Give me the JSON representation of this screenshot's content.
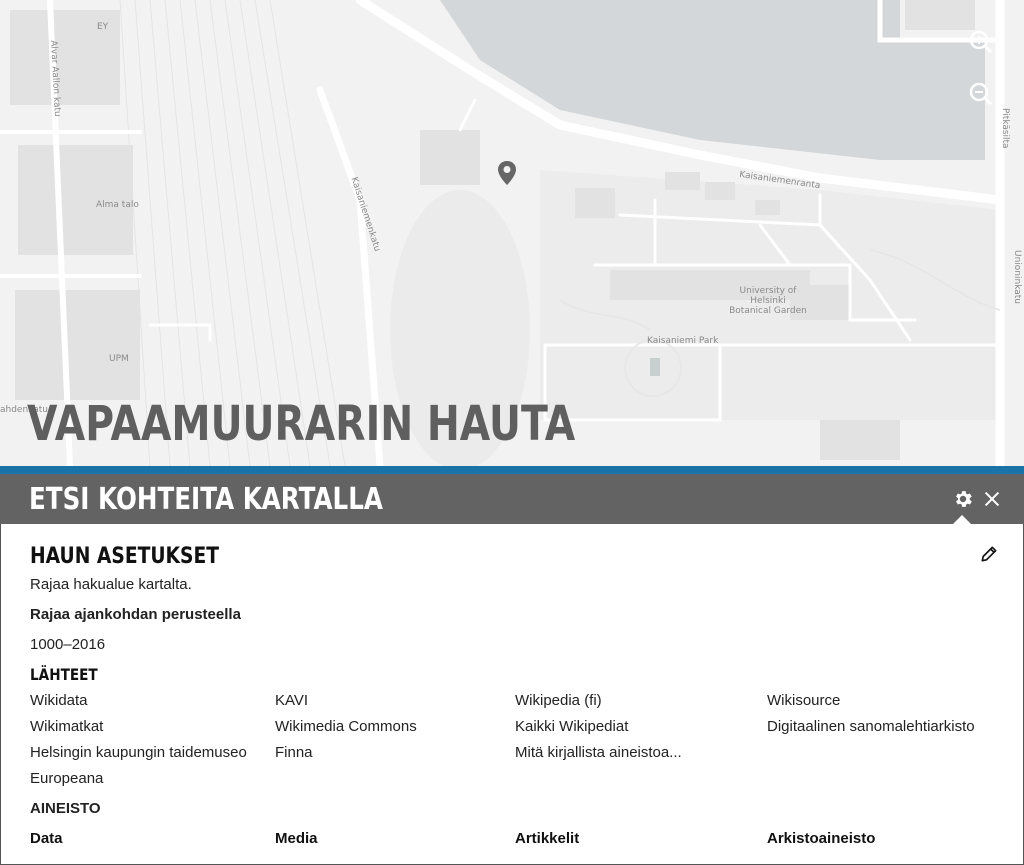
{
  "map": {
    "labels": {
      "ey": "EY",
      "alvar_aallon_katu": "Alvar Aallon katu",
      "alma_talo": "Alma talo",
      "upm": "UPM",
      "lahdenkatu": "ahdenkatu",
      "kaisaniemenkatu": "Kaisaniemenkatu",
      "kaisaniemenranta": "Kaisaniemenranta",
      "botanical_garden": "University of Helsinki Botanical Garden",
      "kaisaniemi_park": "Kaisaniemi Park",
      "pitkasilta": "Pitkäsilta",
      "unioninkatu": "Unioninkatu"
    },
    "zoom_in": "zoom-in",
    "zoom_out": "zoom-out",
    "marker": "map-pin"
  },
  "place_title": "VAPAAMUURARIN HAUTA",
  "panel": {
    "title": "ETSI KOHTEITA KARTALLA",
    "settings_icon": "gear-icon",
    "close_icon": "close-icon",
    "search_settings": {
      "heading": "HAUN ASETUKSET",
      "area_hint": "Rajaa hakualue kartalta.",
      "time_heading": "Rajaa ajankohdan perusteella",
      "time_range": "1000–2016",
      "edit_icon": "pencil-icon"
    },
    "sources": {
      "heading": "LÄHTEET",
      "items": [
        "Wikidata",
        "KAVI",
        "Wikipedia (fi)",
        "Wikisource",
        "Wikimatkat",
        "Wikimedia Commons",
        "Kaikki Wikipediat",
        "Digitaalinen sanomalehtiarkisto",
        "Helsingin kaupungin taidemuseo",
        "Finna",
        "Mitä kirjallista aineistoa...",
        "Europeana"
      ]
    },
    "material": {
      "heading": "AINEISTO",
      "columns": [
        "Data",
        "Media",
        "Artikkelit",
        "Arkistoaineisto"
      ]
    }
  },
  "colors": {
    "accent_blue": "#1a73a6",
    "header_gray": "#636363",
    "water": "#d3d7d9"
  }
}
